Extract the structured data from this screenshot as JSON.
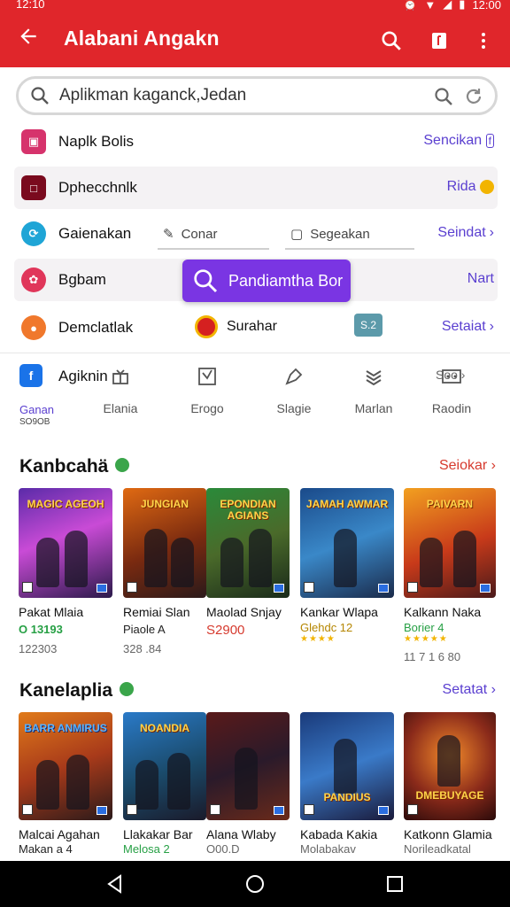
{
  "status": {
    "time": "12:10",
    "right_time": "12:00"
  },
  "appbar": {
    "title": "Alabani Angakn",
    "back_icon": "arrow-left-icon",
    "actions": [
      "search-icon",
      "bookmark-icon",
      "more-vert-icon"
    ]
  },
  "search": {
    "value": "Aplikman kaganck,Jedan"
  },
  "rows": [
    {
      "label": "Naplk Bolis",
      "link": "Sencikan",
      "color": "#d6336c",
      "icon": "grid-icon"
    },
    {
      "label": "Dphecchnlk",
      "link": "Rida",
      "color": "#7a0a1e",
      "icon": "square-icon"
    },
    {
      "label": "Gaienakan",
      "link": "Seindat",
      "color": "#1fa5d6",
      "icon": "refresh-icon"
    },
    {
      "label": "Bgbam",
      "link": "Nart",
      "color": "#e0365a",
      "icon": "flower-icon"
    },
    {
      "label": "Demclatlak",
      "link": "Setaiat",
      "color": "#f0782c",
      "icon": "pin-icon"
    }
  ],
  "chips": [
    {
      "label": "Conar"
    },
    {
      "label": "Segeakan"
    }
  ],
  "row5_mid": {
    "label": "Surahar",
    "badge": "S.2"
  },
  "toast": {
    "text": "Pandiamtha Bor"
  },
  "categories": {
    "first": {
      "title": "Agiknin",
      "label": "Ganan",
      "sub": "SO9OB"
    },
    "items": [
      {
        "label": "Elania",
        "icon": "gift-icon"
      },
      {
        "label": "Erogo",
        "icon": "checkbox-icon"
      },
      {
        "label": "Slagie",
        "icon": "pen-icon"
      },
      {
        "label": "Marlan",
        "icon": "layers-icon"
      },
      {
        "label": "Raodin",
        "icon": "dots-box-icon"
      }
    ],
    "last": "Soo"
  },
  "section1": {
    "title": "Kanbcahä",
    "link": "Seiokar",
    "link_color": "#d63a2e",
    "cards": [
      {
        "title": "MAGIC AGEOH",
        "name": "Pakat Mlaia",
        "meta1": "O 13193",
        "meta1_style": "green",
        "meta2": "122303"
      },
      {
        "title": "JUNGIAN",
        "name": "Remiai Slan",
        "meta1": "Piaole A",
        "meta1_style": "gray",
        "meta2": "328 .84"
      },
      {
        "title": "EPONDIAN AGIANS",
        "name": "Maolad Snjay",
        "meta1": "S2900",
        "meta1_style": "red",
        "meta2": ""
      },
      {
        "title": "JAMAH AWMAR",
        "name": "Kankar Wlapa",
        "meta1": "Glehdc 12",
        "meta1_style": "gold",
        "meta2": ""
      },
      {
        "title": "PAIVARN",
        "name": "Kalkann Naka",
        "meta1": "Borier 4",
        "meta1_style": "green",
        "meta2": "11 7 1 6 80"
      }
    ]
  },
  "section2": {
    "title": "Kanelaplia",
    "link": "Setatat",
    "link_color": "#5a3fd0",
    "cards": [
      {
        "title": "BARR ANMIRUS",
        "name": "Malcai Agahan",
        "meta1": "Makan a 4",
        "meta1_style": "gray"
      },
      {
        "title": "NOANDIA",
        "name": "Llakakar Bar",
        "meta1": "Melosa 2",
        "meta1_style": "green"
      },
      {
        "title": "",
        "name": "Alana Wlaby",
        "meta1": "O00.D",
        "meta1_style": "gray"
      },
      {
        "title": "PANDIUS",
        "name": "Kabada Kakia",
        "meta1": "Molabakav",
        "meta1_style": "gray"
      },
      {
        "title": "DMEBUYAGE",
        "name": "Katkonn Glamia",
        "meta1": "Norileadkatal",
        "meta1_style": "gray"
      }
    ]
  },
  "colors": {
    "brand": "#e0262b",
    "accent": "#5a3fd0",
    "toast": "#7a35e3"
  }
}
